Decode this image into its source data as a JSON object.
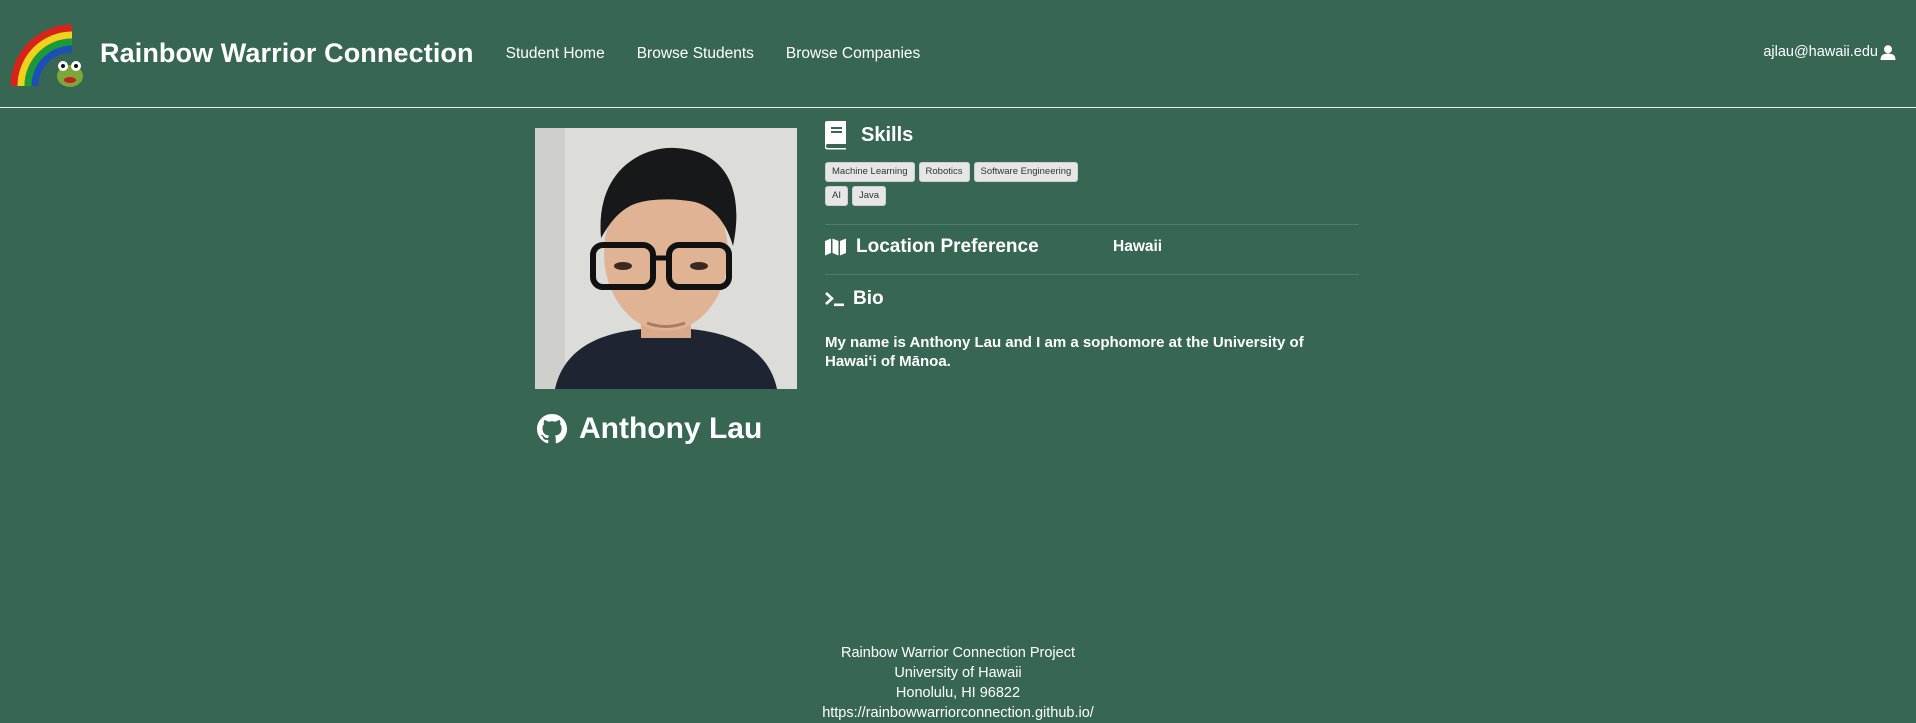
{
  "navbar": {
    "brand_title": "Rainbow Warrior Connection",
    "links": [
      {
        "label": "Student Home"
      },
      {
        "label": "Browse Students"
      },
      {
        "label": "Browse Companies"
      }
    ],
    "user_email": "ajlau@hawaii.edu",
    "user_icon": "user-icon",
    "logo_icon": "rainbow-frog-logo"
  },
  "profile": {
    "name": "Anthony Lau",
    "name_icon": "github-icon",
    "photo": "student-photo"
  },
  "skills": {
    "title": "Skills",
    "icon": "book-icon",
    "tags": [
      "Machine Learning",
      "Robotics",
      "Software Engineering",
      "AI",
      "Java"
    ]
  },
  "location": {
    "title": "Location Preference",
    "icon": "map-icon",
    "value": "Hawaii"
  },
  "bio": {
    "title": "Bio",
    "icon": "terminal-icon",
    "text": "My name is Anthony Lau and I am a sophomore at the University of Hawaiʻi of Mānoa."
  },
  "footer": {
    "line1": "Rainbow Warrior Connection Project",
    "line2": "University of Hawaii",
    "line3": "Honolulu, HI 96822",
    "link": "https://rainbowwarriorconnection.github.io/"
  },
  "colors": {
    "background": "#376752",
    "text": "#ffffff",
    "tag_background": "#e6e6e6"
  }
}
